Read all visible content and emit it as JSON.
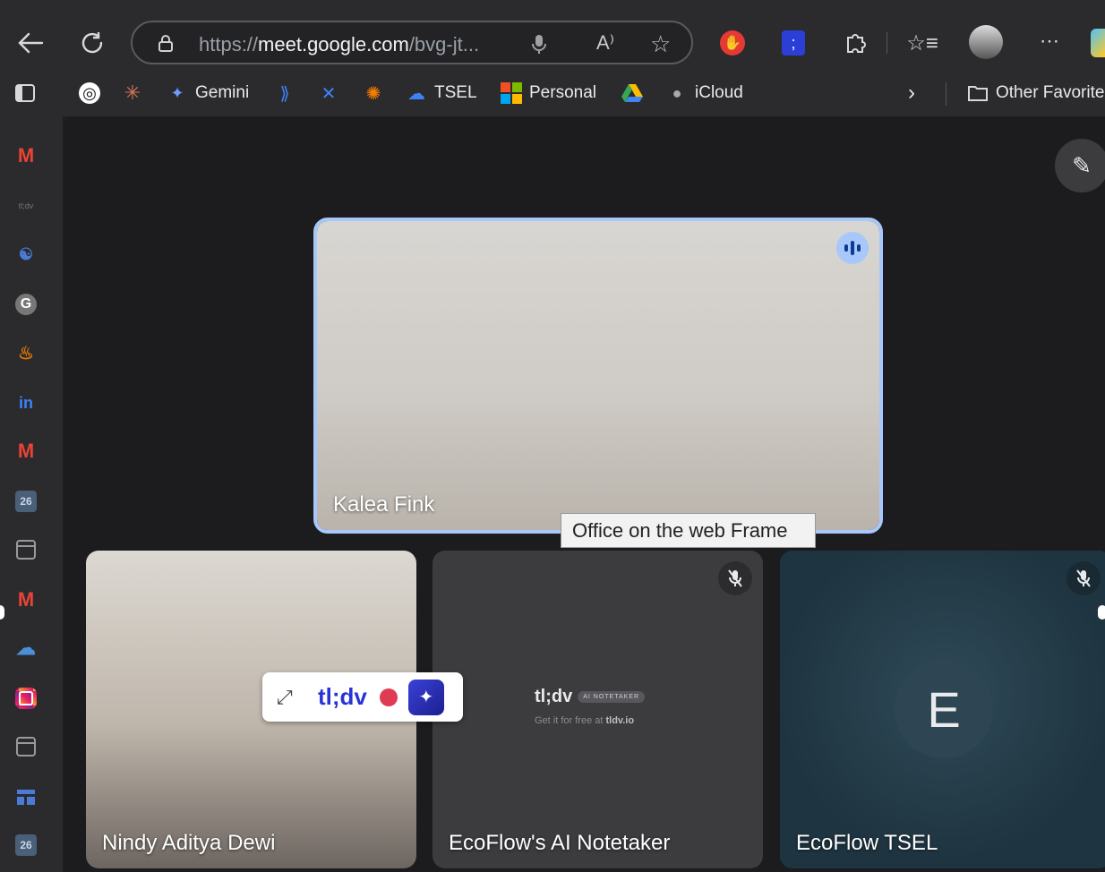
{
  "browser": {
    "url_scheme": "https://",
    "url_host": "meet.google.com",
    "url_path": "/bvg-jt...",
    "read_aloud_label": "A⁾"
  },
  "bookmarks": {
    "gemini": "Gemini",
    "tsel": "TSEL",
    "personal": "Personal",
    "icloud": "iCloud",
    "other": "Other Favorite"
  },
  "sidebar": {
    "tldv_label": "tl;dv",
    "calendar_day": "26",
    "calendar_day_2": "26"
  },
  "meet": {
    "main_speaker": "Kalea Fink",
    "tooltip": "Office on the web Frame",
    "participants": [
      {
        "name": "Nindy Aditya Dewi"
      },
      {
        "name": "EcoFlow's AI Notetaker"
      },
      {
        "name": "EcoFlow TSEL",
        "initial": "E"
      }
    ],
    "notetaker_logo": "tl;dv",
    "notetaker_chip": "AI NOTETAKER",
    "notetaker_sub_prefix": "Get it for free at",
    "notetaker_sub_link": "tldv.io"
  },
  "tldv_widget": {
    "brand": "tl;dv"
  },
  "colors": {
    "speaking_ring": "#a8c7fa",
    "tldv_brand": "#2a34d6",
    "record_dot": "#e03b55"
  }
}
